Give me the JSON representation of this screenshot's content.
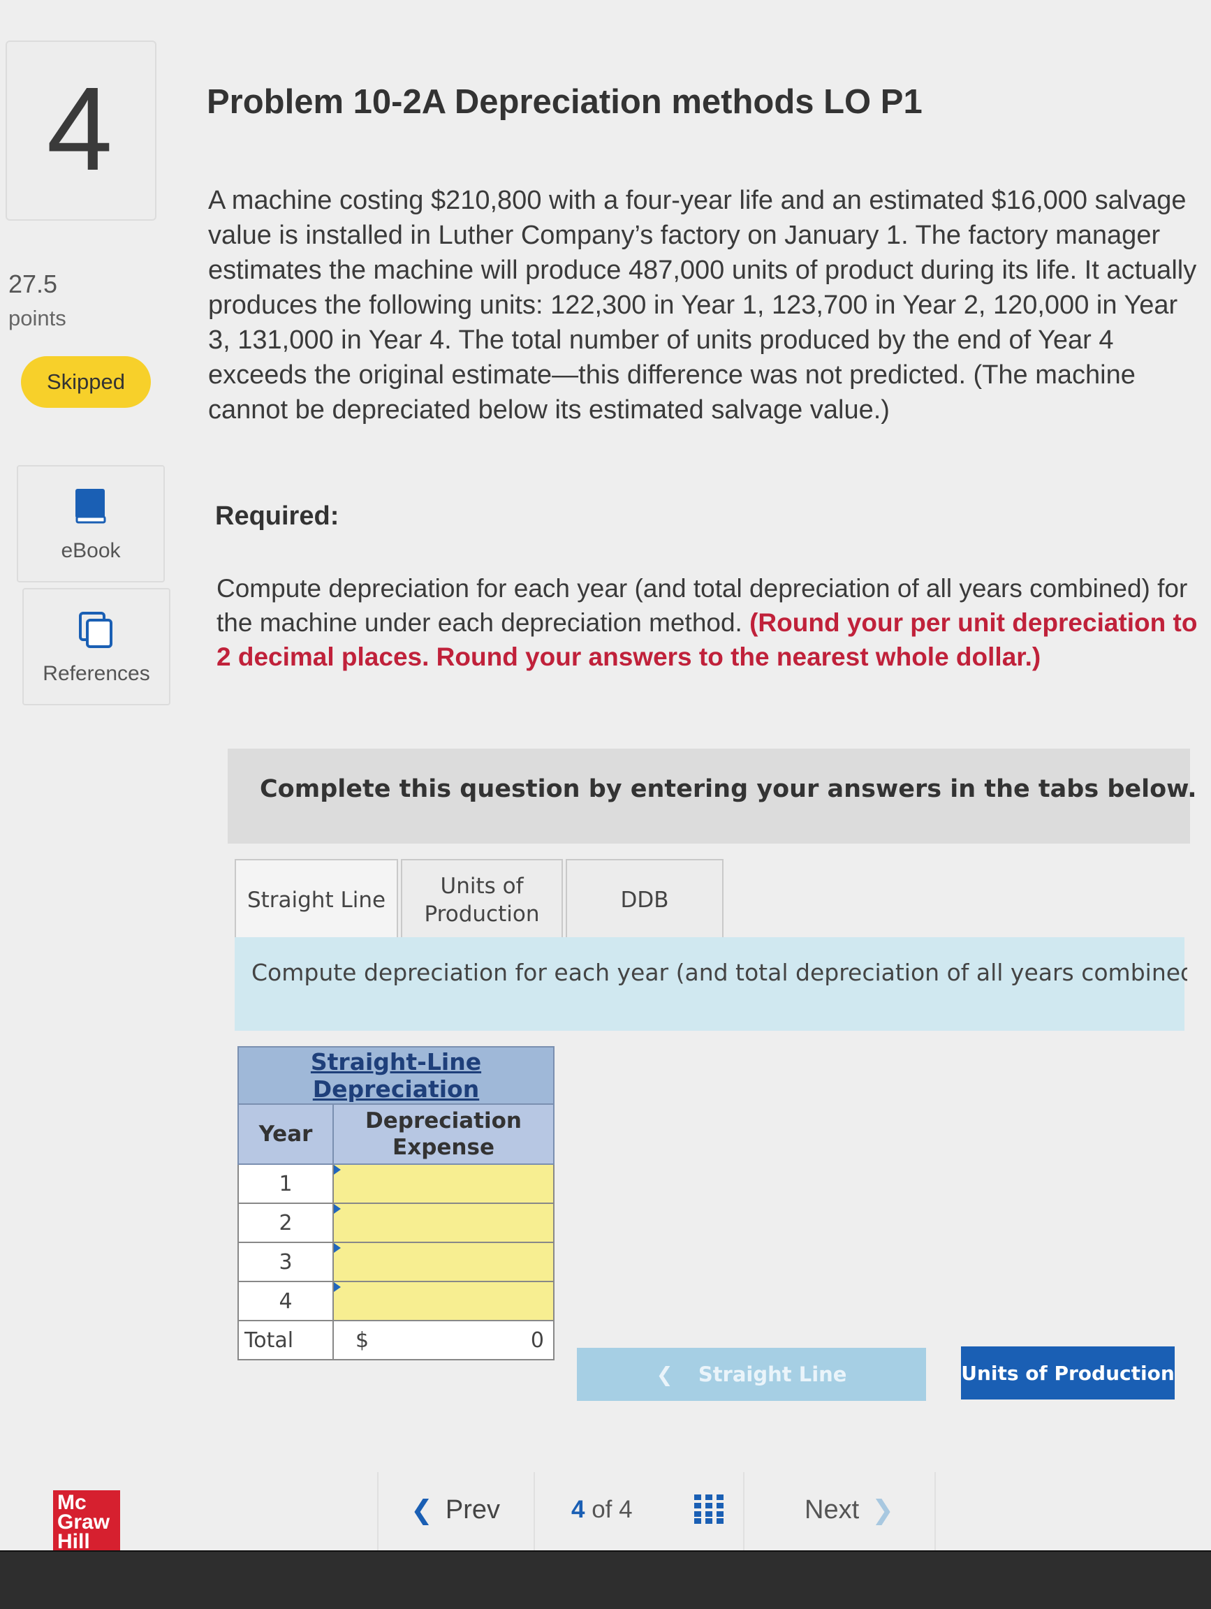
{
  "question": {
    "number": "4",
    "points_value": "27.5",
    "points_label": "points",
    "status": "Skipped"
  },
  "sidebar": {
    "ebook_label": "eBook",
    "references_label": "References"
  },
  "problem": {
    "title": "Problem 10-2A Depreciation methods LO P1",
    "text": "A machine costing $210,800 with a four-year life and an estimated $16,000 salvage value is installed in Luther Company’s factory on January 1. The factory manager estimates the machine will produce 487,000 units of product during its life. It actually produces the following units: 122,300 in Year 1, 123,700 in Year 2, 120,000 in Year 3, 131,000 in Year 4. The total number of units produced by the end of Year 4 exceeds the original estimate—this difference was not predicted. (The machine cannot be depreciated below its estimated salvage value.)",
    "required_label": "Required:",
    "instruction": "Compute depreciation for each year (and total depreciation of all years combined) for the machine under each depreciation method.",
    "instruction_red": "(Round your per unit depreciation to 2 decimal places. Round your answers to the nearest whole dollar.)"
  },
  "banner": "Complete this question by entering your answers in the tabs below.",
  "tabs": [
    {
      "label": "Straight Line",
      "active": true
    },
    {
      "label": "Units of Production",
      "active": false
    },
    {
      "label": "DDB",
      "active": false
    }
  ],
  "tab_instruction": "Compute depreciation for each year (and total depreciation of all years combined) f depreciation.",
  "table": {
    "caption": "Straight-Line Depreciation",
    "col_year": "Year",
    "col_expense": "Depreciation Expense",
    "rows": [
      {
        "year": "1",
        "value": ""
      },
      {
        "year": "2",
        "value": ""
      },
      {
        "year": "3",
        "value": ""
      },
      {
        "year": "4",
        "value": ""
      }
    ],
    "total_label": "Total",
    "total_currency": "$",
    "total_value": "0"
  },
  "tab_nav": {
    "prev_label": "Straight Line",
    "next_label": "Units of Production"
  },
  "page_nav": {
    "prev_label": "Prev",
    "current": "4",
    "of_label": "of",
    "total": "4",
    "next_label": "Next"
  },
  "logo": {
    "line1": "Mc",
    "line2": "Graw",
    "line3": "Hill"
  },
  "colors": {
    "accent": "#1a5fb4",
    "skipped": "#f7d02a",
    "input_fill": "#f7ee91",
    "table_header": "#b7c7e3",
    "instruction_red": "#c0213a"
  }
}
